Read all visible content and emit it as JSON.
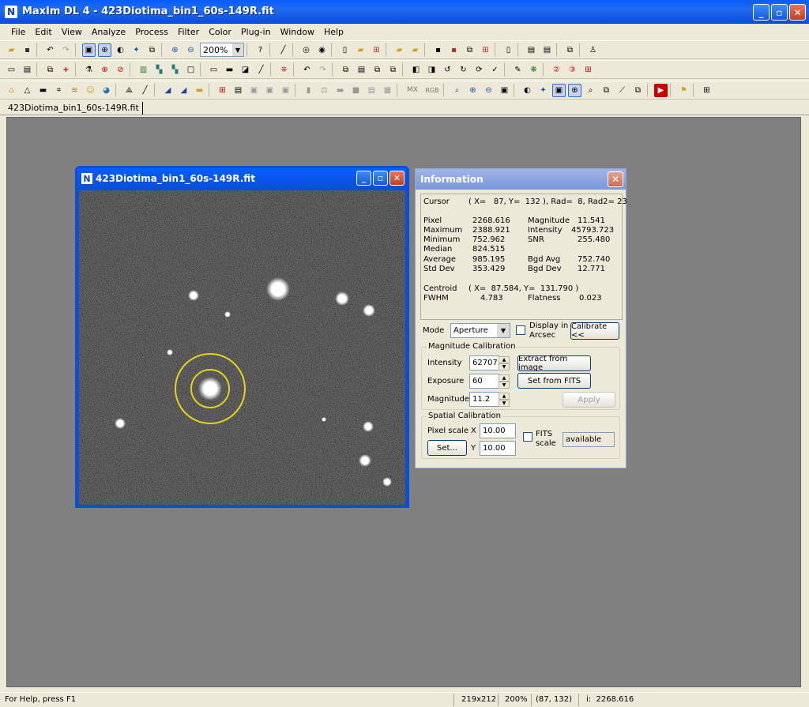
{
  "app": {
    "title": "MaxIm DL 4 - 423Diotima_bin1_60s-149R.fit",
    "icon_letter": "N"
  },
  "menu": [
    "File",
    "Edit",
    "View",
    "Analyze",
    "Process",
    "Filter",
    "Color",
    "Plug-in",
    "Window",
    "Help"
  ],
  "toolbar": {
    "zoom_value": "200%"
  },
  "doc_tab": "423Diotima_bin1_60s-149R.fit",
  "image_window": {
    "title": "423Diotima_bin1_60s-149R.fit"
  },
  "info": {
    "title": "Information",
    "cursor_label": "Cursor",
    "cursor_value": "( X=   87, Y=  132 ), Rad=  8, Rad2= 23",
    "stats_left": [
      {
        "label": "Pixel",
        "value": "2268.616"
      },
      {
        "label": "Maximum",
        "value": "2388.921"
      },
      {
        "label": "Minimum",
        "value": "752.962"
      },
      {
        "label": "Median",
        "value": "824.515"
      },
      {
        "label": "Average",
        "value": "985.195"
      },
      {
        "label": "Std Dev",
        "value": "353.429"
      }
    ],
    "stats_right": [
      {
        "label": "Magnitude",
        "value": "11.541"
      },
      {
        "label": "Intensity",
        "value": "45793.723"
      },
      {
        "label": "SNR",
        "value": "255.480"
      },
      {
        "label": "",
        "value": ""
      },
      {
        "label": "Bgd Avg",
        "value": "752.740"
      },
      {
        "label": "Bgd Dev",
        "value": "12.771"
      }
    ],
    "centroid_label": "Centroid",
    "centroid_value": "( X=  87.584, Y=  131.790 )",
    "fwhm_label": "FWHM",
    "fwhm_value": "4.783",
    "flatness_label": "Flatness",
    "flatness_value": "0.023",
    "mode_label": "Mode",
    "mode_value": "Aperture",
    "display_arcsec_label": "Display in Arcsec",
    "calibrate_button": "Calibrate <<",
    "mag_cal_title": "Magnitude Calibration",
    "intensity_label": "Intensity",
    "intensity_value": "62707.",
    "exposure_label": "Exposure",
    "exposure_value": "60",
    "magnitude_label": "Magnitude",
    "magnitude_value": "11.2",
    "extract_button": "Extract from image",
    "setfits_button": "Set from FITS",
    "apply_button": "Apply",
    "spatial_cal_title": "Spatial Calibration",
    "pixel_scale_label": "Pixel scale",
    "x_label": "X",
    "y_label": "Y",
    "x_scale": "10.00",
    "y_scale": "10.00",
    "set_button": "Set...",
    "fits_scale_label": "FITS scale",
    "fits_scale_value": "available"
  },
  "status": {
    "help": "For Help, press F1",
    "size": "219x212",
    "zoom": "200%",
    "coords": "(87, 132)",
    "intensity": "i:  2268.616"
  }
}
